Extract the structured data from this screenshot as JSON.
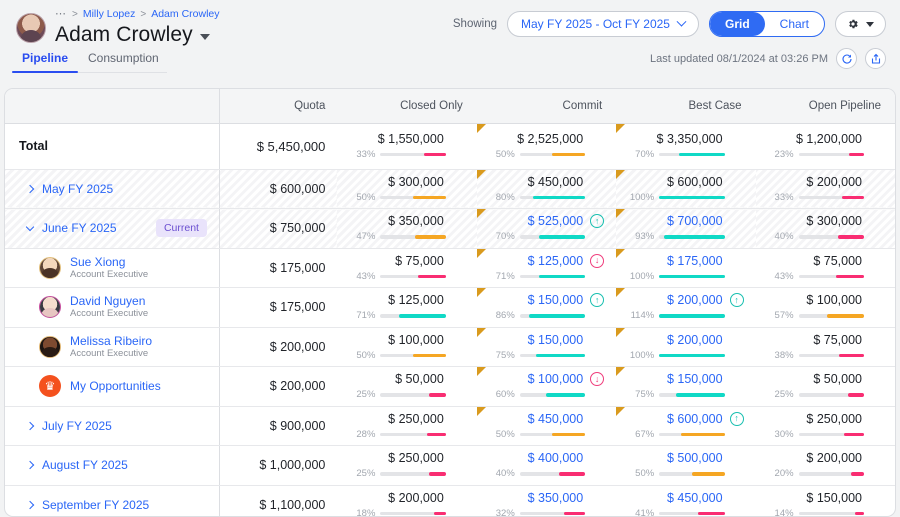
{
  "header": {
    "breadcrumb_dots": "⋯",
    "breadcrumb": [
      "Milly Lopez",
      "Adam Crowley"
    ],
    "title": "Adam Crowley",
    "tabs": [
      {
        "label": "Pipeline",
        "active": true
      },
      {
        "label": "Consumption",
        "active": false
      }
    ],
    "showing_label": "Showing",
    "period_value": "May FY 2025 - Oct FY 2025",
    "view_toggle": [
      {
        "label": "Grid",
        "selected": true
      },
      {
        "label": "Chart",
        "selected": false
      }
    ],
    "settings_icon": "gear-icon",
    "last_updated": "Last updated 08/1/2024 at 03:26 PM",
    "refresh_icon": "refresh-icon",
    "share_icon": "share-icon"
  },
  "colors": {
    "accent_blue": "#2a66f6",
    "selected_blue": "#2f6bf3",
    "pink": "#f92d72",
    "orange": "#f5a623",
    "teal": "#10d9c6",
    "badge_purple_bg": "#e9e3fb",
    "badge_purple_text": "#6b4fd0",
    "marker_orange": "#d99a1d"
  },
  "table": {
    "columns": [
      "",
      "Quota",
      "Closed Only",
      "Commit",
      "Best Case",
      "Open Pipeline"
    ],
    "rows": [
      {
        "type": "total",
        "label": "Total",
        "quota": "$ 5,450,000",
        "striped": false,
        "metrics": [
          {
            "value": "$ 1,550,000",
            "pct": "33%",
            "bar": 33,
            "color": "pink",
            "link": false,
            "marker": false,
            "indicator": null
          },
          {
            "value": "$ 2,525,000",
            "pct": "50%",
            "bar": 50,
            "color": "orange",
            "link": false,
            "marker": true,
            "indicator": null
          },
          {
            "value": "$ 3,350,000",
            "pct": "70%",
            "bar": 70,
            "color": "teal",
            "link": false,
            "marker": true,
            "indicator": null
          },
          {
            "value": "$ 1,200,000",
            "pct": "23%",
            "bar": 23,
            "color": "pink",
            "link": false,
            "marker": false,
            "indicator": null
          }
        ]
      },
      {
        "type": "month",
        "label": "May FY 2025",
        "quota": "$ 600,000",
        "striped": true,
        "expanded": false,
        "badge": null,
        "metrics": [
          {
            "value": "$ 300,000",
            "pct": "50%",
            "bar": 50,
            "color": "orange",
            "link": false,
            "marker": false,
            "indicator": null
          },
          {
            "value": "$ 450,000",
            "pct": "80%",
            "bar": 80,
            "color": "teal",
            "link": false,
            "marker": true,
            "indicator": null
          },
          {
            "value": "$ 600,000",
            "pct": "100%",
            "bar": 100,
            "color": "teal",
            "link": false,
            "marker": true,
            "indicator": null
          },
          {
            "value": "$ 200,000",
            "pct": "33%",
            "bar": 33,
            "color": "pink",
            "link": false,
            "marker": false,
            "indicator": null
          }
        ]
      },
      {
        "type": "month",
        "label": "June FY 2025",
        "quota": "$ 750,000",
        "striped": true,
        "expanded": true,
        "badge": "Current",
        "metrics": [
          {
            "value": "$ 350,000",
            "pct": "47%",
            "bar": 47,
            "color": "orange",
            "link": false,
            "marker": false,
            "indicator": null
          },
          {
            "value": "$ 525,000",
            "pct": "70%",
            "bar": 70,
            "color": "teal",
            "link": true,
            "marker": true,
            "indicator": "up"
          },
          {
            "value": "$ 700,000",
            "pct": "93%",
            "bar": 93,
            "color": "teal",
            "link": true,
            "marker": true,
            "indicator": null
          },
          {
            "value": "$ 300,000",
            "pct": "40%",
            "bar": 40,
            "color": "pink",
            "link": false,
            "marker": false,
            "indicator": null
          }
        ]
      },
      {
        "type": "person",
        "label": "Sue Xiong",
        "role": "Account Executive",
        "avatar": "avatar-sue-xiong",
        "quota": "$ 175,000",
        "striped": false,
        "metrics": [
          {
            "value": "$ 75,000",
            "pct": "43%",
            "bar": 43,
            "color": "pink",
            "link": false,
            "marker": false,
            "indicator": null
          },
          {
            "value": "$ 125,000",
            "pct": "71%",
            "bar": 71,
            "color": "teal",
            "link": true,
            "marker": true,
            "indicator": "down"
          },
          {
            "value": "$ 175,000",
            "pct": "100%",
            "bar": 100,
            "color": "teal",
            "link": true,
            "marker": true,
            "indicator": null
          },
          {
            "value": "$ 75,000",
            "pct": "43%",
            "bar": 43,
            "color": "pink",
            "link": false,
            "marker": false,
            "indicator": null
          }
        ]
      },
      {
        "type": "person",
        "label": "David Nguyen",
        "role": "Account Executive",
        "avatar": "avatar-david-nguyen",
        "quota": "$ 175,000",
        "striped": false,
        "metrics": [
          {
            "value": "$ 125,000",
            "pct": "71%",
            "bar": 71,
            "color": "teal",
            "link": false,
            "marker": false,
            "indicator": null
          },
          {
            "value": "$ 150,000",
            "pct": "86%",
            "bar": 86,
            "color": "teal",
            "link": true,
            "marker": true,
            "indicator": "up"
          },
          {
            "value": "$ 200,000",
            "pct": "114%",
            "bar": 100,
            "color": "teal",
            "link": true,
            "marker": true,
            "indicator": "up"
          },
          {
            "value": "$ 100,000",
            "pct": "57%",
            "bar": 57,
            "color": "orange",
            "link": false,
            "marker": false,
            "indicator": null
          }
        ]
      },
      {
        "type": "person",
        "label": "Melissa Ribeiro",
        "role": "Account Executive",
        "avatar": "avatar-melissa-ribeiro",
        "quota": "$ 200,000",
        "striped": false,
        "metrics": [
          {
            "value": "$ 100,000",
            "pct": "50%",
            "bar": 50,
            "color": "orange",
            "link": false,
            "marker": false,
            "indicator": null
          },
          {
            "value": "$ 150,000",
            "pct": "75%",
            "bar": 75,
            "color": "teal",
            "link": true,
            "marker": true,
            "indicator": null
          },
          {
            "value": "$ 200,000",
            "pct": "100%",
            "bar": 100,
            "color": "teal",
            "link": true,
            "marker": true,
            "indicator": null
          },
          {
            "value": "$ 75,000",
            "pct": "38%",
            "bar": 38,
            "color": "pink",
            "link": false,
            "marker": false,
            "indicator": null
          }
        ]
      },
      {
        "type": "opportunities",
        "label": "My Opportunities",
        "icon": "crown-icon",
        "quota": "$ 200,000",
        "striped": false,
        "metrics": [
          {
            "value": "$ 50,000",
            "pct": "25%",
            "bar": 25,
            "color": "pink",
            "link": false,
            "marker": false,
            "indicator": null
          },
          {
            "value": "$ 100,000",
            "pct": "60%",
            "bar": 60,
            "color": "teal",
            "link": true,
            "marker": true,
            "indicator": "down"
          },
          {
            "value": "$ 150,000",
            "pct": "75%",
            "bar": 75,
            "color": "teal",
            "link": true,
            "marker": true,
            "indicator": null
          },
          {
            "value": "$ 50,000",
            "pct": "25%",
            "bar": 25,
            "color": "pink",
            "link": false,
            "marker": false,
            "indicator": null
          }
        ]
      },
      {
        "type": "month",
        "label": "July FY 2025",
        "quota": "$ 900,000",
        "striped": false,
        "expanded": false,
        "badge": null,
        "metrics": [
          {
            "value": "$ 250,000",
            "pct": "28%",
            "bar": 28,
            "color": "pink",
            "link": false,
            "marker": false,
            "indicator": null
          },
          {
            "value": "$ 450,000",
            "pct": "50%",
            "bar": 50,
            "color": "orange",
            "link": true,
            "marker": true,
            "indicator": null
          },
          {
            "value": "$ 600,000",
            "pct": "67%",
            "bar": 67,
            "color": "orange",
            "link": true,
            "marker": true,
            "indicator": "up"
          },
          {
            "value": "$ 250,000",
            "pct": "30%",
            "bar": 30,
            "color": "pink",
            "link": false,
            "marker": false,
            "indicator": null
          }
        ]
      },
      {
        "type": "month",
        "label": "August FY 2025",
        "quota": "$ 1,000,000",
        "striped": false,
        "expanded": false,
        "badge": null,
        "metrics": [
          {
            "value": "$ 250,000",
            "pct": "25%",
            "bar": 25,
            "color": "pink",
            "link": false,
            "marker": false,
            "indicator": null
          },
          {
            "value": "$ 400,000",
            "pct": "40%",
            "bar": 40,
            "color": "pink",
            "link": true,
            "marker": false,
            "indicator": null
          },
          {
            "value": "$ 500,000",
            "pct": "50%",
            "bar": 50,
            "color": "orange",
            "link": true,
            "marker": false,
            "indicator": null
          },
          {
            "value": "$ 200,000",
            "pct": "20%",
            "bar": 20,
            "color": "pink",
            "link": false,
            "marker": false,
            "indicator": null
          }
        ]
      },
      {
        "type": "month",
        "label": "September FY 2025",
        "quota": "$ 1,100,000",
        "striped": false,
        "expanded": false,
        "badge": null,
        "metrics": [
          {
            "value": "$ 200,000",
            "pct": "18%",
            "bar": 18,
            "color": "pink",
            "link": false,
            "marker": false,
            "indicator": null
          },
          {
            "value": "$ 350,000",
            "pct": "32%",
            "bar": 32,
            "color": "pink",
            "link": true,
            "marker": false,
            "indicator": null
          },
          {
            "value": "$ 450,000",
            "pct": "41%",
            "bar": 41,
            "color": "pink",
            "link": true,
            "marker": false,
            "indicator": null
          },
          {
            "value": "$ 150,000",
            "pct": "14%",
            "bar": 14,
            "color": "pink",
            "link": false,
            "marker": false,
            "indicator": null
          }
        ]
      }
    ]
  }
}
